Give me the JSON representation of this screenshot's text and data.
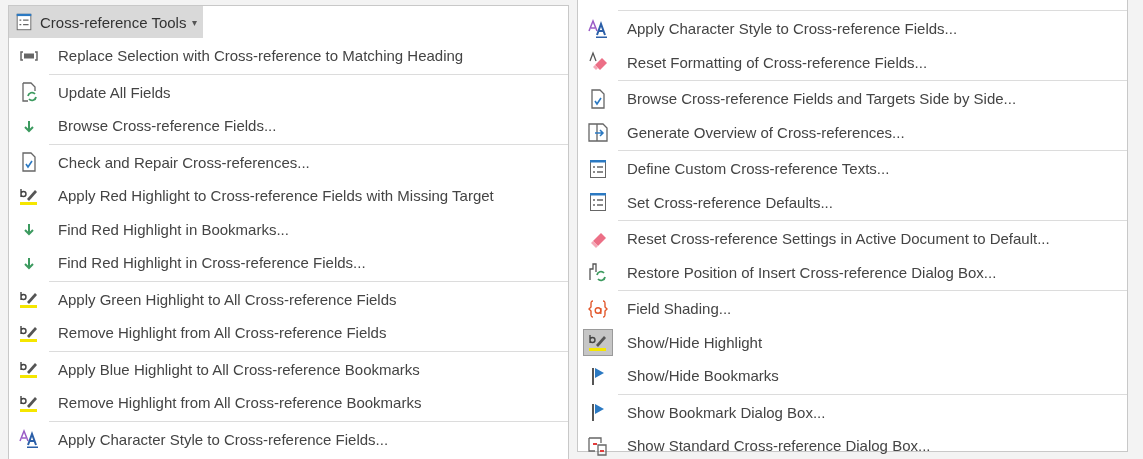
{
  "toolbar_button": {
    "label": "Cross-reference Tools",
    "caret": "▾"
  },
  "left_menu": {
    "groups": [
      {
        "items": [
          {
            "label": "Replace Selection with Cross-reference to Matching Heading",
            "kind": "bracket",
            "checked": false
          }
        ]
      },
      {
        "items": [
          {
            "label": "Update All Fields",
            "kind": "doc-refresh",
            "checked": false
          },
          {
            "label": "Browse Cross-reference Fields...",
            "kind": "down-arrow",
            "checked": false
          }
        ]
      },
      {
        "items": [
          {
            "label": "Check and Repair Cross-references...",
            "kind": "doc-check",
            "checked": false
          },
          {
            "label": "Apply Red Highlight to Cross-reference Fields with Missing Target",
            "kind": "highlighter",
            "checked": false
          },
          {
            "label": "Find Red Highlight in Bookmarks...",
            "kind": "down-arrow",
            "checked": false
          },
          {
            "label": "Find Red Highlight in Cross-reference Fields...",
            "kind": "down-arrow",
            "checked": false
          }
        ]
      },
      {
        "items": [
          {
            "label": "Apply Green Highlight to All Cross-reference Fields",
            "kind": "highlighter",
            "checked": false
          },
          {
            "label": "Remove Highlight from All Cross-reference Fields",
            "kind": "highlighter",
            "checked": false
          }
        ]
      },
      {
        "items": [
          {
            "label": "Apply Blue Highlight to All Cross-reference Bookmarks",
            "kind": "highlighter",
            "checked": false
          },
          {
            "label": "Remove Highlight from All Cross-reference Bookmarks",
            "kind": "highlighter",
            "checked": false
          }
        ]
      },
      {
        "items": [
          {
            "label": "Apply Character Style to Cross-reference Fields...",
            "kind": "char-style",
            "checked": false
          }
        ]
      }
    ]
  },
  "right_menu": {
    "groups": [
      {
        "items": [
          {
            "label": "Apply Character Style to Cross-reference Fields...",
            "kind": "char-style",
            "checked": false
          },
          {
            "label": "Reset Formatting of Cross-reference Fields...",
            "kind": "eraser-letter",
            "checked": false
          }
        ]
      },
      {
        "items": [
          {
            "label": "Browse Cross-reference Fields and Targets Side by Side...",
            "kind": "doc-check",
            "checked": false
          },
          {
            "label": "Generate Overview of Cross-references...",
            "kind": "doc-export",
            "checked": false
          }
        ]
      },
      {
        "items": [
          {
            "label": "Define Custom Cross-reference Texts...",
            "kind": "form",
            "checked": false
          },
          {
            "label": "Set Cross-reference Defaults...",
            "kind": "form",
            "checked": false
          }
        ]
      },
      {
        "items": [
          {
            "label": "Reset Cross-reference Settings in Active Document to Default...",
            "kind": "eraser",
            "checked": false
          },
          {
            "label": "Restore Position of Insert Cross-reference Dialog Box...",
            "kind": "restore",
            "checked": false
          }
        ]
      },
      {
        "items": [
          {
            "label": "Field Shading...",
            "kind": "braces",
            "checked": false
          },
          {
            "label": "Show/Hide Highlight",
            "kind": "highlighter",
            "checked": true
          },
          {
            "label": "Show/Hide Bookmarks",
            "kind": "flag",
            "checked": false
          }
        ]
      },
      {
        "items": [
          {
            "label": "Show Bookmark Dialog Box...",
            "kind": "flag",
            "checked": false
          },
          {
            "label": "Show Standard Cross-reference Dialog Box...",
            "kind": "dialog",
            "checked": false
          }
        ]
      }
    ]
  }
}
